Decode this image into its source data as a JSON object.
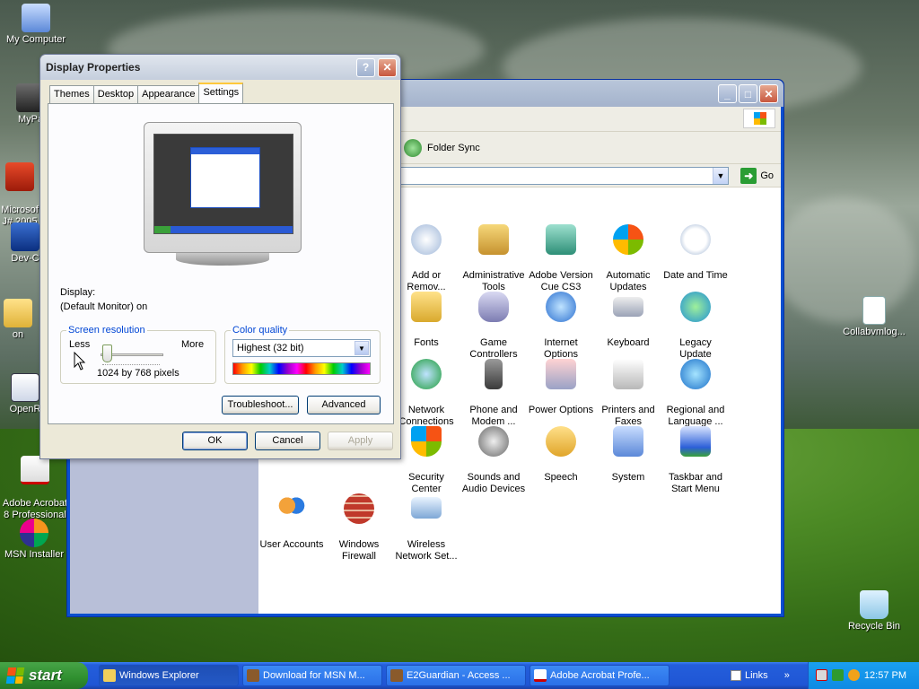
{
  "desktop": {
    "icons": [
      {
        "label": "My Computer"
      },
      {
        "label": "MyPa"
      },
      {
        "label": "Microsof\nJ# 2005"
      },
      {
        "label": "Dev-C"
      },
      {
        "label": "on"
      },
      {
        "label": "OpenR"
      },
      {
        "label": "Adobe Acrobat\n8 Professional"
      },
      {
        "label": "MSN Installer"
      },
      {
        "label": "Collabvmlog..."
      },
      {
        "label": "Recycle Bin"
      }
    ]
  },
  "explorer": {
    "folder_sync": "Folder Sync",
    "go_label": "Go",
    "control_panel_items": [
      {
        "label": "Add or\nRemov..."
      },
      {
        "label": "Administrative\nTools"
      },
      {
        "label": "Adobe Version\nCue CS3"
      },
      {
        "label": "Automatic\nUpdates"
      },
      {
        "label": "Date and Time"
      },
      {
        "label": "Fonts"
      },
      {
        "label": "Game\nControllers"
      },
      {
        "label": "Internet\nOptions"
      },
      {
        "label": "Keyboard"
      },
      {
        "label": "Legacy\nUpdate"
      },
      {
        "label": "Network\nConnections"
      },
      {
        "label": "Phone and\nModem ..."
      },
      {
        "label": "Power Options"
      },
      {
        "label": "Printers and\nFaxes"
      },
      {
        "label": "Regional and\nLanguage ..."
      },
      {
        "label": "Security\nCenter"
      },
      {
        "label": "Sounds and\nAudio Devices"
      },
      {
        "label": "Speech"
      },
      {
        "label": "System"
      },
      {
        "label": "Taskbar and\nStart Menu"
      },
      {
        "label": "User Accounts"
      },
      {
        "label": "Windows\nFirewall"
      },
      {
        "label": "Wireless\nNetwork Set..."
      }
    ]
  },
  "dialog": {
    "title": "Display Properties",
    "help": "?",
    "close": "✕",
    "tabs": [
      "Themes",
      "Desktop",
      "Appearance",
      "Settings"
    ],
    "active_tab": "Settings",
    "display_label": "Display:",
    "display_value": "(Default Monitor) on",
    "resolution": {
      "legend": "Screen resolution",
      "less": "Less",
      "more": "More",
      "value_text": "1024 by 768 pixels"
    },
    "color_quality": {
      "legend": "Color quality",
      "selected": "Highest (32 bit)"
    },
    "buttons": {
      "troubleshoot": "Troubleshoot...",
      "advanced": "Advanced",
      "ok": "OK",
      "cancel": "Cancel",
      "apply": "Apply"
    }
  },
  "taskbar": {
    "start": "start",
    "tasks": [
      {
        "label": "Windows Explorer",
        "pressed": true
      },
      {
        "label": "Download for MSN M..."
      },
      {
        "label": "E2Guardian - Access ..."
      },
      {
        "label": "Adobe Acrobat Profe..."
      }
    ],
    "links": "Links",
    "chevron": "»",
    "clock": "12:57 PM"
  },
  "colors": {
    "accent": "#0a4fd0",
    "start_green": "#2f8f2f",
    "taskbar_blue": "#245edb"
  }
}
